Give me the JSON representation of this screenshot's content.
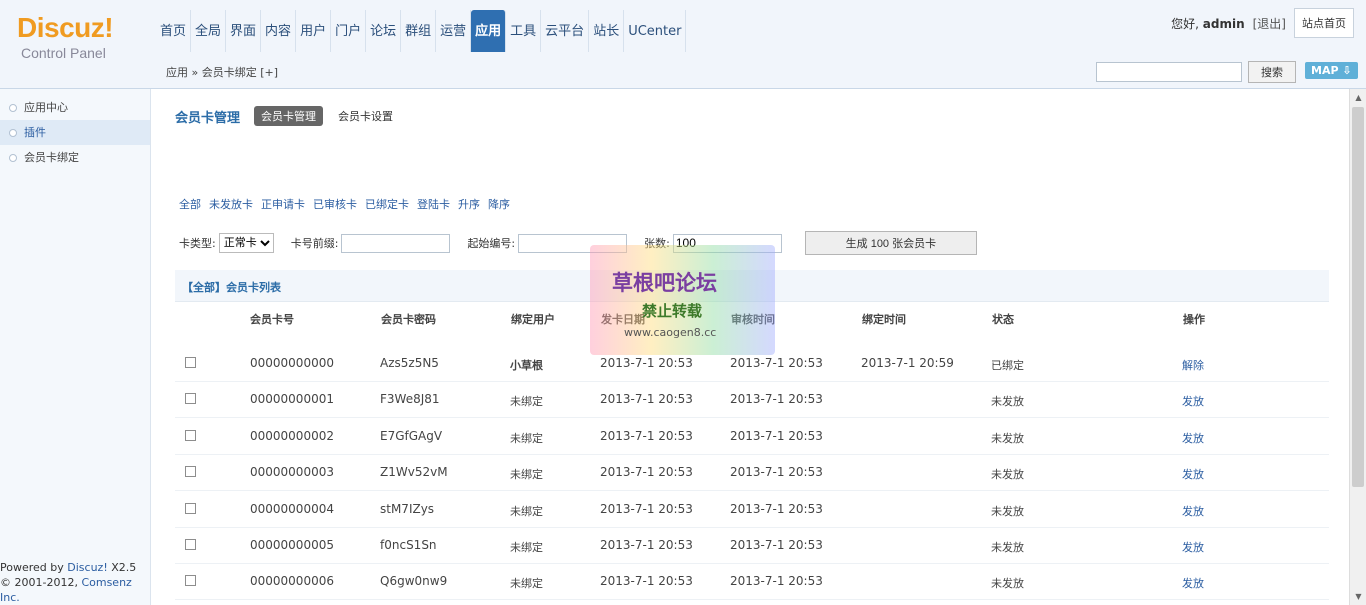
{
  "logo": {
    "brand": "Discuz!",
    "sub": "Control Panel"
  },
  "nav": [
    "首页",
    "全局",
    "界面",
    "内容",
    "用户",
    "门户",
    "论坛",
    "群组",
    "运营",
    "应用",
    "工具",
    "云平台",
    "站长",
    "UCenter"
  ],
  "nav_active_index": 9,
  "top": {
    "greeting": "您好,",
    "user": "admin",
    "logout": "[退出]",
    "site_home": "站点首页"
  },
  "breadcrumb": "应用 » 会员卡绑定 [+]",
  "search": {
    "button": "搜索",
    "map": "MAP"
  },
  "sidebar": {
    "items": [
      "应用中心",
      "插件",
      "会员卡绑定"
    ],
    "footer_powered_prefix": "Powered by ",
    "footer_powered": "Discuz!",
    "footer_version": " X2.5",
    "footer_copy_prefix": "© 2001-2012, ",
    "footer_copy": "Comsenz Inc."
  },
  "main": {
    "title": "会员卡管理",
    "tabs": [
      "会员卡管理",
      "会员卡设置"
    ],
    "filters": [
      "全部",
      "未发放卡",
      "正申请卡",
      "已审核卡",
      "已绑定卡",
      "登陆卡",
      "升序",
      "降序"
    ],
    "form": {
      "type_label": "卡类型:",
      "type_value": "正常卡",
      "prefix_label": "卡号前缀:",
      "start_label": "起始编号:",
      "count_label": "张数:",
      "count_value": "100",
      "generate_button": "生成 100 张会员卡"
    },
    "list_title": "【全部】会员卡列表",
    "columns": [
      "会员卡号",
      "会员卡密码",
      "绑定用户",
      "发卡日期",
      "审核时间",
      "绑定时间",
      "状态",
      "操作"
    ],
    "rows": [
      {
        "card": "00000000000",
        "password": "Azs5z5N5",
        "user": "小草根",
        "issue": "2013-7-1 20:53",
        "review": "2013-7-1 20:53",
        "bind": "2013-7-1 20:59",
        "status": "已绑定",
        "action": "解除"
      },
      {
        "card": "00000000001",
        "password": "F3We8J81",
        "user": "未绑定",
        "issue": "2013-7-1 20:53",
        "review": "2013-7-1 20:53",
        "bind": "",
        "status": "未发放",
        "action": "发放"
      },
      {
        "card": "00000000002",
        "password": "E7GfGAgV",
        "user": "未绑定",
        "issue": "2013-7-1 20:53",
        "review": "2013-7-1 20:53",
        "bind": "",
        "status": "未发放",
        "action": "发放"
      },
      {
        "card": "00000000003",
        "password": "Z1Wv52vM",
        "user": "未绑定",
        "issue": "2013-7-1 20:53",
        "review": "2013-7-1 20:53",
        "bind": "",
        "status": "未发放",
        "action": "发放"
      },
      {
        "card": "00000000004",
        "password": "stM7IZys",
        "user": "未绑定",
        "issue": "2013-7-1 20:53",
        "review": "2013-7-1 20:53",
        "bind": "",
        "status": "未发放",
        "action": "发放"
      },
      {
        "card": "00000000005",
        "password": "f0ncS1Sn",
        "user": "未绑定",
        "issue": "2013-7-1 20:53",
        "review": "2013-7-1 20:53",
        "bind": "",
        "status": "未发放",
        "action": "发放"
      },
      {
        "card": "00000000006",
        "password": "Q6gw0nw9",
        "user": "未绑定",
        "issue": "2013-7-1 20:53",
        "review": "2013-7-1 20:53",
        "bind": "",
        "status": "未发放",
        "action": "发放"
      }
    ]
  },
  "watermark": {
    "line1": "草根吧论坛",
    "line2": "禁止转载",
    "line3": "www.caogen8.cc"
  },
  "colors": {
    "accent": "#2f6fb1",
    "link": "#2b5da1",
    "logo": "#f09b21"
  }
}
